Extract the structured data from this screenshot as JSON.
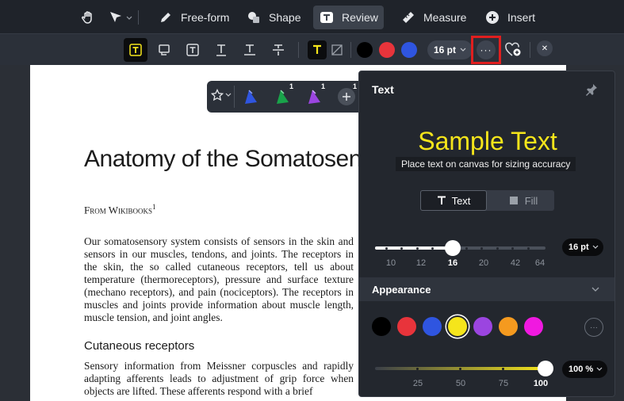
{
  "topbar": {
    "tools": [
      {
        "label": "Free-form",
        "icon": "pen-icon"
      },
      {
        "label": "Shape",
        "icon": "shape-icon"
      },
      {
        "label": "Review",
        "icon": "review-text-icon",
        "active": true
      },
      {
        "label": "Measure",
        "icon": "ruler-icon"
      },
      {
        "label": "Insert",
        "icon": "plus-circle-icon"
      }
    ]
  },
  "subbar": {
    "font_size": "16 pt",
    "colors": [
      "#000000",
      "#e8343b",
      "#2f55e0"
    ]
  },
  "document": {
    "title": "Anatomy of the Somatosen",
    "from": "From Wikibooks",
    "from_sup": "1",
    "para1": "Our somatosensory system consists of sensors in the skin and sensors in our muscles, tendons, and joints. The receptors in the skin, the so called cutaneous receptors, tell us about temperature (thermoreceptors), pressure and surface texture (mechano receptors), and pain (nociceptors). The receptors in muscles and joints provide information about muscle length, muscle tension, and joint angles.",
    "subheading": "Cutaneous receptors",
    "para2": "Sensory information from Meissner corpuscles and rapidly adapting afferents leads to adjustment of grip force when objects are lifted. These afferents respond with a brief"
  },
  "stampbar": {
    "counts": [
      "1",
      "1",
      "1"
    ]
  },
  "panel": {
    "title": "Text",
    "sample_text": "Sample Text",
    "sample_hint": "Place text on canvas for sizing accuracy",
    "tabs": {
      "text": "Text",
      "fill": "Fill"
    },
    "size_ticks": [
      "10",
      "12",
      "16",
      "20",
      "42",
      "64"
    ],
    "size_value": "16 pt",
    "appearance_label": "Appearance",
    "palette": [
      "#000000",
      "#e8343b",
      "#2f55e0",
      "#f5e51b",
      "#9b45e0",
      "#f59a1f",
      "#f019e0"
    ],
    "selected_color": "#f5e51b",
    "opacity_ticks": [
      "25",
      "50",
      "75",
      "100"
    ],
    "opacity_value": "100 %",
    "opacity": 100
  }
}
